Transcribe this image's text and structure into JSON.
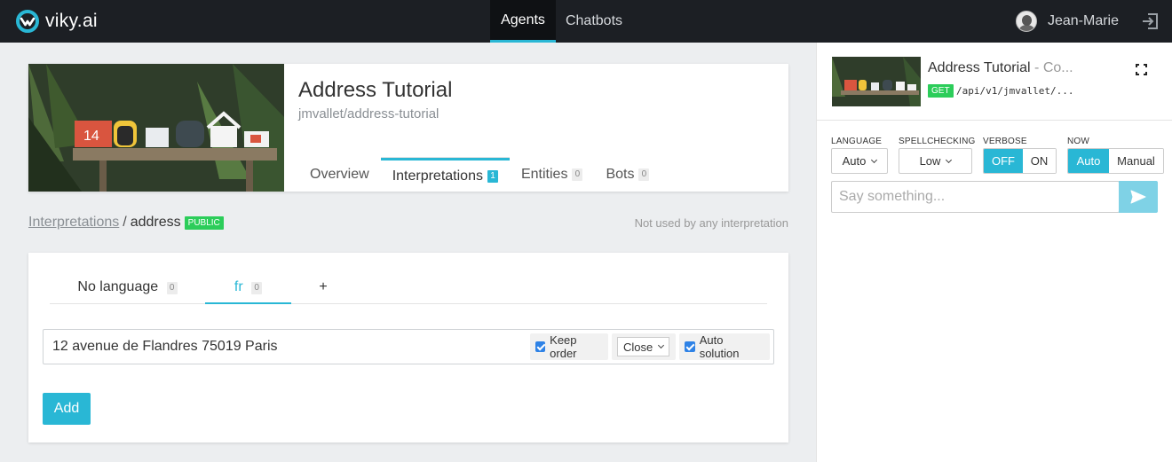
{
  "brand": {
    "name": "viky.ai"
  },
  "nav": {
    "tabs": [
      {
        "label": "Agents"
      },
      {
        "label": "Chatbots"
      }
    ]
  },
  "user": {
    "name": "Jean-Marie"
  },
  "agent": {
    "title": "Address Tutorial",
    "slug": "jmvallet/address-tutorial",
    "tabs": [
      {
        "label": "Overview"
      },
      {
        "label": "Interpretations",
        "count": "1"
      },
      {
        "label": "Entities",
        "count": "0"
      },
      {
        "label": "Bots",
        "count": "0"
      }
    ]
  },
  "breadcrumb": {
    "parent": "Interpretations",
    "separator": "/",
    "current": "address",
    "badge": "PUBLIC"
  },
  "usage_note": "Not used by any interpretation",
  "language_tabs": [
    {
      "label": "No language",
      "count": "0"
    },
    {
      "label": "fr",
      "count": "0"
    },
    {
      "label": "+"
    }
  ],
  "expression": {
    "text": "12 avenue de Flandres 75019 Paris",
    "keep_order_label": "Keep order",
    "proximity_value": "Close",
    "auto_solution_label": "Auto solution"
  },
  "add_button": "Add",
  "console": {
    "title": "Address Tutorial",
    "subtitle": " - Co...",
    "method": "GET",
    "path": "/api/v1/jmvallet/...",
    "language": {
      "label": "LANGUAGE",
      "value": "Auto"
    },
    "spellchecking": {
      "label": "SPELLCHECKING",
      "value": "Low"
    },
    "verbose": {
      "label": "VERBOSE",
      "options": [
        "OFF",
        "ON"
      ],
      "selected": "OFF"
    },
    "now": {
      "label": "NOW",
      "options": [
        "Auto",
        "Manual"
      ],
      "selected": "Auto"
    },
    "input_placeholder": "Say something..."
  },
  "colors": {
    "accent": "#29b7d5",
    "topbar": "#1c1f24",
    "public_badge": "#2ccd5a",
    "checkbox": "#2e82e6"
  }
}
